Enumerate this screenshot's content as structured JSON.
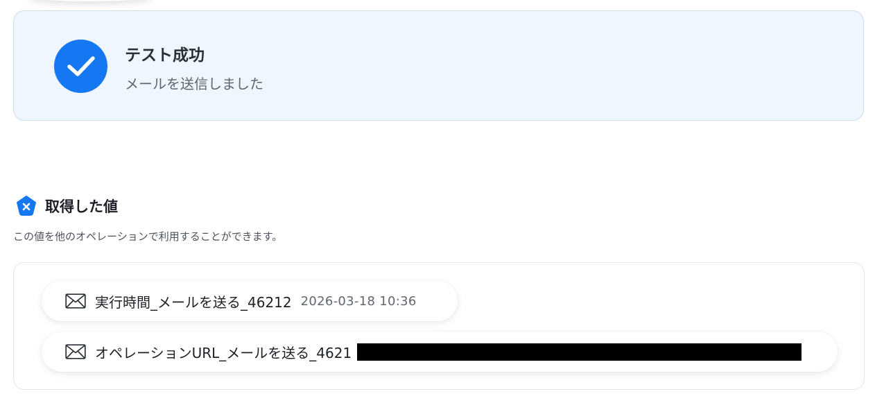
{
  "success": {
    "title": "テスト成功",
    "message": "メールを送信しました",
    "icon": "check-icon",
    "accent": "#1677f2",
    "background": "#eff6ff"
  },
  "values": {
    "title": "取得した値",
    "description": "この値を他のオペレーションで利用することができます。",
    "brand_icon": "pentagon-x-icon",
    "items": [
      {
        "icon": "mail-icon",
        "label": "実行時間_メールを送る_46212",
        "value": "2026-03-18 10:36"
      },
      {
        "icon": "mail-icon",
        "label": "オペレーションURL_メールを送る_4621",
        "value_redacted": true
      }
    ]
  }
}
